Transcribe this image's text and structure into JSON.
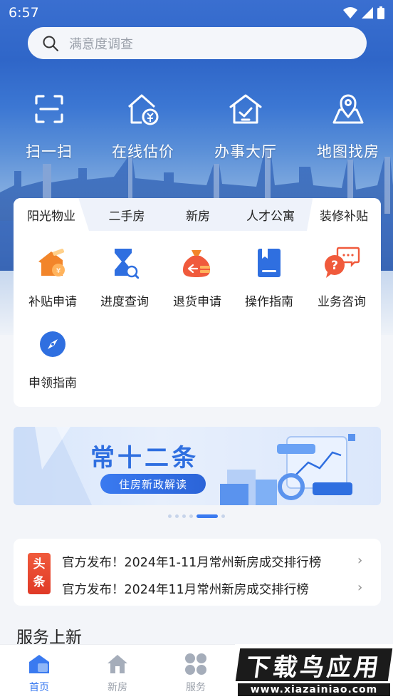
{
  "status_bar": {
    "time": "6:57"
  },
  "search": {
    "placeholder": "满意度调查"
  },
  "shortcuts": [
    {
      "label": "扫一扫",
      "icon": "scan-icon"
    },
    {
      "label": "在线估价",
      "icon": "house-price-icon"
    },
    {
      "label": "办事大厅",
      "icon": "house-check-icon"
    },
    {
      "label": "地图找房",
      "icon": "map-pin-icon"
    }
  ],
  "card": {
    "tabs": [
      "阳光物业",
      "二手房",
      "新房",
      "人才公寓",
      "装修补贴"
    ],
    "active_tab": "阳光物业",
    "items": [
      {
        "label": "补贴申请",
        "icon": "subsidy-house-icon"
      },
      {
        "label": "进度查询",
        "icon": "hourglass-search-icon"
      },
      {
        "label": "退货申请",
        "icon": "refund-bag-icon"
      },
      {
        "label": "操作指南",
        "icon": "guide-book-icon"
      },
      {
        "label": "业务咨询",
        "icon": "consult-chat-icon"
      },
      {
        "label": "申领指南",
        "icon": "compass-icon"
      }
    ]
  },
  "banner": {
    "title": "常十二条",
    "subtitle": "住房新政解读",
    "slide_count": 6,
    "active_slide": 5
  },
  "news": {
    "badge_top": "头",
    "badge_bottom": "条",
    "items": [
      "官方发布！2024年1-11月常州新房成交排行榜",
      "官方发布！2024年11月常州新房成交排行榜"
    ]
  },
  "section_title": "服务上新",
  "bottom_nav": [
    {
      "label": "首页",
      "icon": "home-active-icon",
      "active": true
    },
    {
      "label": "新房",
      "icon": "house-icon",
      "active": false
    },
    {
      "label": "服务",
      "icon": "grid-dots-icon",
      "active": false
    }
  ],
  "watermark": {
    "main": "下载鸟应用",
    "sub": "www.xiazainiao.com"
  },
  "colors": {
    "accent": "#3a7af0",
    "orange": "#f2852a",
    "red": "#e03a27"
  }
}
